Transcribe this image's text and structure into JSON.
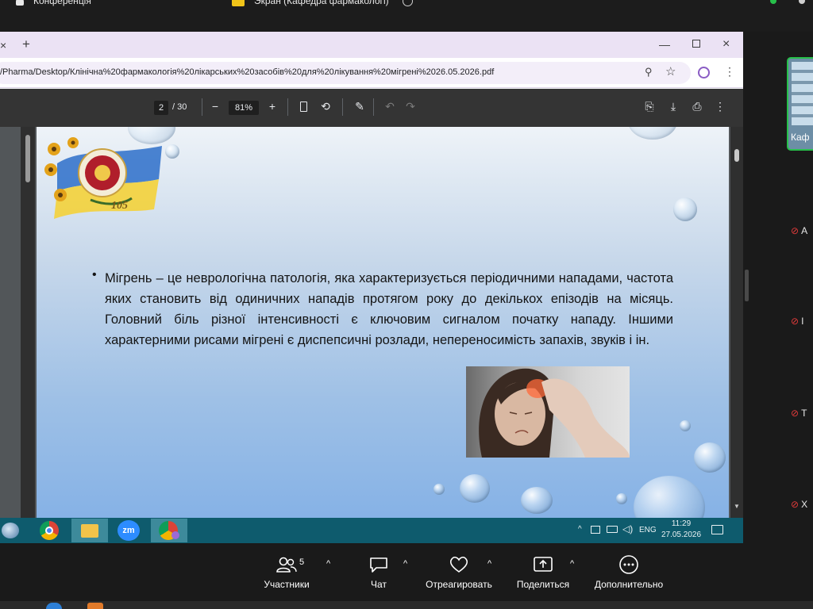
{
  "zoom_top": {
    "tab1_label": "Конференція",
    "tab2_label": "Экран (Кафедра фармакологі)"
  },
  "browser": {
    "new_tab": "+",
    "close_tab": "×",
    "url": "/Pharma/Desktop/Клінічна%20фармакологія%20лікарських%20засобів%20для%20лікування%20мігрені%2026.05.2026.pdf"
  },
  "pdf_toolbar": {
    "page_current": "2",
    "page_total": "/ 30",
    "zoom_value": "81%",
    "zoom_out": "−",
    "zoom_in": "+"
  },
  "slide": {
    "logo_number": "105",
    "bullet": "•",
    "text": "Мігрень – це неврологічна патологія, яка характеризується періодичними нападами, частота яких становить від одиничних нападів протягом року до декількох епізодів на місяць. Головний біль різної інтенсивності є ключовим сигналом початку нападу. Іншими характерними рисами мігрені є диспепсичні розлади, непереносимість запахів, звуків і ін."
  },
  "taskbar": {
    "zoom_app_label": "zm",
    "tray_lang": "ENG",
    "time": "11:29",
    "date": "27.05.2026"
  },
  "side_panel": {
    "thumb_label": "Каф",
    "participants": [
      {
        "initial": "А"
      },
      {
        "initial": "І"
      },
      {
        "initial": "Т"
      },
      {
        "initial": "Х"
      }
    ]
  },
  "zoom_toolbar": {
    "participants_label": "Участники",
    "participants_count": "5",
    "chat_label": "Чат",
    "react_label": "Отреагировать",
    "share_label": "Поделиться",
    "more_label": "Дополнительно"
  },
  "colors": {
    "taskbar": "#0e5b6d",
    "tabbar": "#ebe2f4",
    "pdf_toolbar": "#343434",
    "active_thumb_border": "#27c04a"
  }
}
